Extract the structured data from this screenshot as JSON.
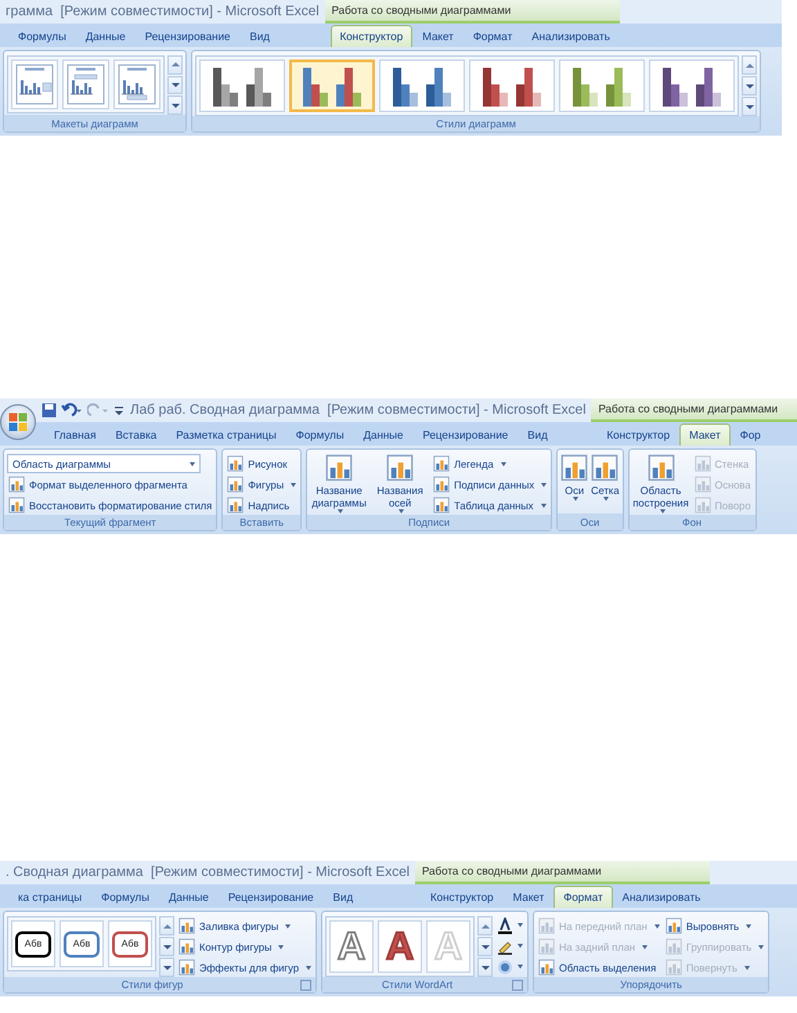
{
  "ribbons": [
    {
      "office_button": false,
      "quick_access_toolbar": false,
      "title": "грамма  [Режим совместимости] - Microsoft Excel",
      "context_title": "Работа со сводными диаграммами",
      "tabs": [
        {
          "label": "Формулы",
          "selected": false
        },
        {
          "label": "Данные",
          "selected": false
        },
        {
          "label": "Рецензирование",
          "selected": false
        },
        {
          "label": "Вид",
          "selected": false
        }
      ],
      "context_tabs": [
        {
          "label": "Конструктор",
          "selected": true
        },
        {
          "label": "Макет",
          "selected": false
        },
        {
          "label": "Формат",
          "selected": false
        },
        {
          "label": "Анализировать",
          "selected": false
        }
      ],
      "groups": [
        {
          "label": "Макеты диаграмм",
          "launcher": false,
          "controls": [
            {
              "kind": "layout_gallery",
              "items": [
                {
                  "selected": false
                },
                {
                  "selected": false
                },
                {
                  "selected": false
                }
              ]
            }
          ]
        },
        {
          "label": "Стили диаграмм",
          "launcher": false,
          "controls": [
            {
              "kind": "style_gallery",
              "items": [
                {
                  "selected": false,
                  "bars": [
                    {
                      "color": "#595959"
                    },
                    {
                      "color": "#a6a6a6"
                    },
                    {
                      "color": "#7f7f7f"
                    }
                  ]
                },
                {
                  "selected": true,
                  "bars": [
                    {
                      "color": "#4f81bd"
                    },
                    {
                      "color": "#c0504d"
                    },
                    {
                      "color": "#9bbb59"
                    }
                  ]
                },
                {
                  "selected": false,
                  "bars": [
                    {
                      "color": "#2c5d98"
                    },
                    {
                      "color": "#4f81bd"
                    },
                    {
                      "color": "#a7bfde"
                    }
                  ]
                },
                {
                  "selected": false,
                  "bars": [
                    {
                      "color": "#943634"
                    },
                    {
                      "color": "#c0504d"
                    },
                    {
                      "color": "#e6b9b8"
                    }
                  ]
                },
                {
                  "selected": false,
                  "bars": [
                    {
                      "color": "#76933c"
                    },
                    {
                      "color": "#9bbb59"
                    },
                    {
                      "color": "#d7e4bd"
                    }
                  ]
                },
                {
                  "selected": false,
                  "bars": [
                    {
                      "color": "#5f497a"
                    },
                    {
                      "color": "#8064a2"
                    },
                    {
                      "color": "#ccc1da"
                    }
                  ]
                }
              ]
            }
          ]
        }
      ]
    },
    {
      "office_button": true,
      "quick_access_toolbar": true,
      "title": "Лаб раб. Сводная диаграмма  [Режим совместимости] - Microsoft Excel",
      "context_title": "Работа со сводными диаграммами",
      "tabs": [
        {
          "label": "Главная",
          "selected": false
        },
        {
          "label": "Вставка",
          "selected": false
        },
        {
          "label": "Разметка страницы",
          "selected": false
        },
        {
          "label": "Формулы",
          "selected": false
        },
        {
          "label": "Данные",
          "selected": false
        },
        {
          "label": "Рецензирование",
          "selected": false
        },
        {
          "label": "Вид",
          "selected": false
        }
      ],
      "context_tabs": [
        {
          "label": "Конструктор",
          "selected": false
        },
        {
          "label": "Макет",
          "selected": true
        },
        {
          "label": "Фор",
          "selected": false
        }
      ],
      "groups": [
        {
          "label": "Текущий фрагмент",
          "launcher": false,
          "controls": [
            {
              "kind": "stack",
              "items": [
                {
                  "kind": "combo",
                  "label": "Область диаграммы",
                  "menu": true,
                  "disabled": false
                },
                {
                  "kind": "button",
                  "label": "Формат выделенного фрагмента",
                  "menu": false,
                  "disabled": false
                },
                {
                  "kind": "button",
                  "label": "Восстановить форматирование стиля",
                  "menu": false,
                  "disabled": false
                }
              ]
            }
          ]
        },
        {
          "label": "Вставить",
          "launcher": false,
          "controls": [
            {
              "kind": "stack",
              "items": [
                {
                  "kind": "button",
                  "label": "Рисунок",
                  "menu": false,
                  "disabled": false
                },
                {
                  "kind": "button",
                  "label": "Фигуры",
                  "menu": true,
                  "disabled": false
                },
                {
                  "kind": "button",
                  "label": "Надпись",
                  "menu": false,
                  "disabled": false
                }
              ]
            }
          ]
        },
        {
          "label": "Подписи",
          "launcher": false,
          "controls": [
            {
              "kind": "big",
              "label": "Название диаграммы",
              "menu": true
            },
            {
              "kind": "big",
              "label": "Названия осей",
              "menu": true
            },
            {
              "kind": "stack",
              "items": [
                {
                  "kind": "button",
                  "label": "Легенда",
                  "menu": true,
                  "disabled": false
                },
                {
                  "kind": "button",
                  "label": "Подписи данных",
                  "menu": true,
                  "disabled": false
                },
                {
                  "kind": "button",
                  "label": "Таблица данных",
                  "menu": true,
                  "disabled": false
                }
              ]
            }
          ]
        },
        {
          "label": "Оси",
          "launcher": false,
          "controls": [
            {
              "kind": "big",
              "label": "Оси",
              "menu": true
            },
            {
              "kind": "big",
              "label": "Сетка",
              "menu": true
            }
          ]
        },
        {
          "label": "Фон",
          "launcher": false,
          "controls": [
            {
              "kind": "big",
              "label": "Область построения",
              "menu": true
            },
            {
              "kind": "stack",
              "items": [
                {
                  "kind": "button",
                  "label": "Стенка",
                  "menu": false,
                  "disabled": true
                },
                {
                  "kind": "button",
                  "label": "Основа",
                  "menu": false,
                  "disabled": true
                },
                {
                  "kind": "button",
                  "label": "Поворо",
                  "menu": false,
                  "disabled": true
                }
              ]
            }
          ]
        }
      ]
    },
    {
      "office_button": false,
      "quick_access_toolbar": false,
      "title": ". Сводная диаграмма  [Режим совместимости] - Microsoft Excel",
      "context_title": "Работа со сводными диаграммами",
      "tabs": [
        {
          "label": "ка страницы",
          "selected": false
        },
        {
          "label": "Формулы",
          "selected": false
        },
        {
          "label": "Данные",
          "selected": false
        },
        {
          "label": "Рецензирование",
          "selected": false
        },
        {
          "label": "Вид",
          "selected": false
        }
      ],
      "context_tabs": [
        {
          "label": "Конструктор",
          "selected": false
        },
        {
          "label": "Макет",
          "selected": false
        },
        {
          "label": "Формат",
          "selected": true
        },
        {
          "label": "Анализировать",
          "selected": false
        }
      ],
      "groups": [
        {
          "label": "Стили фигур",
          "launcher": true,
          "controls": [
            {
              "kind": "shape_gallery",
              "items": [
                {
                  "text": "Абв",
                  "color": "#000000"
                },
                {
                  "text": "Абв",
                  "color": "#4f81bd"
                },
                {
                  "text": "Абв",
                  "color": "#c0504d"
                }
              ]
            },
            {
              "kind": "stack",
              "items": [
                {
                  "kind": "button",
                  "label": "Заливка фигуры",
                  "menu": true,
                  "disabled": false
                },
                {
                  "kind": "button",
                  "label": "Контур фигуры",
                  "menu": true,
                  "disabled": false
                },
                {
                  "kind": "button",
                  "label": "Эффекты для фигур",
                  "menu": true,
                  "disabled": false
                }
              ]
            }
          ]
        },
        {
          "label": "Стили WordArt",
          "launcher": true,
          "controls": [
            {
              "kind": "wordart_gallery",
              "items": [
                {
                  "text": "A",
                  "kind": "outline"
                },
                {
                  "text": "A",
                  "kind": "filled"
                },
                {
                  "text": "A",
                  "kind": "light"
                }
              ]
            },
            {
              "kind": "icon_stack",
              "items": [
                {
                  "menu": true
                },
                {
                  "menu": true
                },
                {
                  "menu": true
                }
              ]
            }
          ]
        },
        {
          "label": "Упорядочить",
          "launcher": false,
          "controls": [
            {
              "kind": "stack",
              "items": [
                {
                  "kind": "button",
                  "label": "На передний план",
                  "menu": true,
                  "disabled": true
                },
                {
                  "kind": "button",
                  "label": "На задний план",
                  "menu": true,
                  "disabled": true
                },
                {
                  "kind": "button",
                  "label": "Область выделения",
                  "menu": false,
                  "disabled": false
                }
              ]
            },
            {
              "kind": "stack",
              "items": [
                {
                  "kind": "button",
                  "label": "Выровнять",
                  "menu": true,
                  "disabled": false
                },
                {
                  "kind": "button",
                  "label": "Группировать",
                  "menu": true,
                  "disabled": true
                },
                {
                  "kind": "button",
                  "label": "Повернуть",
                  "menu": true,
                  "disabled": true
                }
              ]
            }
          ]
        }
      ]
    }
  ]
}
